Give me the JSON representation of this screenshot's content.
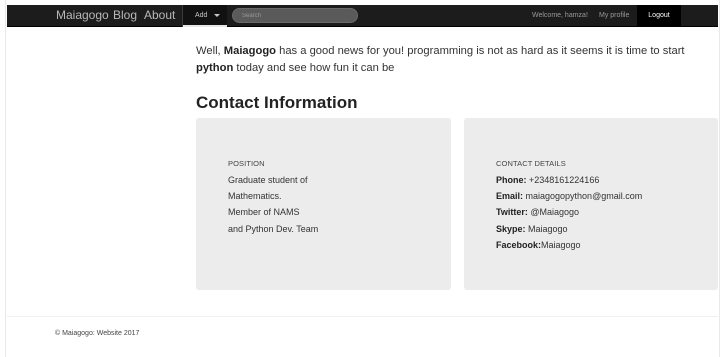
{
  "navbar": {
    "brand": "Maiagogo",
    "links": [
      {
        "label": "Blog"
      },
      {
        "label": "About"
      }
    ],
    "add_dropdown": "Add",
    "search_placeholder": "Search",
    "welcome": "Welcome, hamza!",
    "my_profile": "My profile",
    "logout": "Logout"
  },
  "intro": {
    "pre": "Well, ",
    "bold1": "Maiagogo",
    "mid": " has a good news for you! programming is not as hard as it seems it is time to start ",
    "bold2": "python",
    "post": " today and see how fun it can be"
  },
  "contact": {
    "title": "Contact Information",
    "position": {
      "heading": "POSITION",
      "lines": [
        "Graduate student of",
        "Mathematics.",
        "Member of NAMS",
        "and Python Dev. Team"
      ]
    },
    "details": {
      "heading": "CONTACT DETAILS",
      "items": [
        {
          "label": "Phone:",
          "value": " +2348161224166"
        },
        {
          "label": "Email:",
          "value": " maiagogopython@gmail.com"
        },
        {
          "label": "Twitter:",
          "value": " @Maiagogo"
        },
        {
          "label": "Skype:",
          "value": " Maiagogo"
        },
        {
          "label": "Facebook:",
          "value": "Maiagogo"
        }
      ]
    }
  },
  "footer": {
    "text": "© Maiagogo: Website 2017"
  }
}
